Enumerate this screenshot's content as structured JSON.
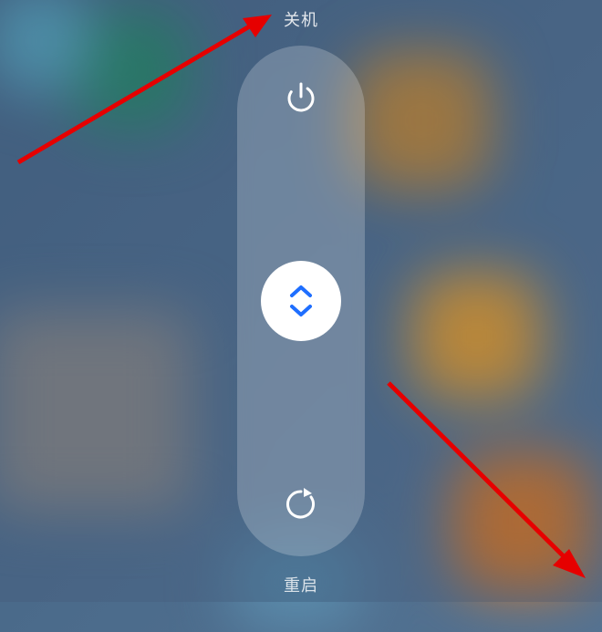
{
  "labels": {
    "shutdown": "关机",
    "restart": "重启"
  },
  "colors": {
    "annotation_arrow": "#e60000",
    "thumb_chevron": "#1e6eff"
  }
}
